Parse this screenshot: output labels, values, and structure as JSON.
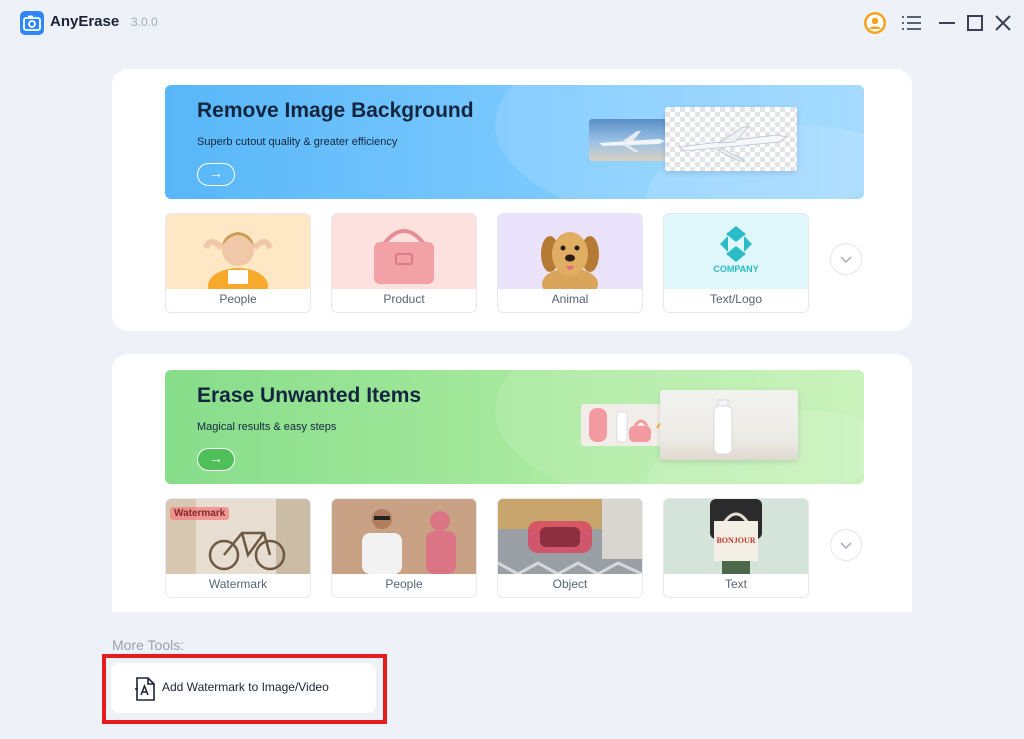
{
  "app": {
    "name": "AnyErase",
    "version": "3.0.0"
  },
  "titlebar": {
    "icons": [
      "user-avatar-icon",
      "menu-icon",
      "minimize-icon",
      "maximize-icon",
      "close-icon"
    ]
  },
  "remove_bg": {
    "title": "Remove Image Background",
    "subtitle": "Superb cutout quality & greater efficiency",
    "categories": [
      "People",
      "Product",
      "Animal",
      "Text/Logo"
    ],
    "logo_text": "COMPANY"
  },
  "erase": {
    "title": "Erase Unwanted Items",
    "subtitle": "Magical results & easy steps",
    "categories": [
      "Watermark",
      "People",
      "Object",
      "Text"
    ],
    "watermark_tag": "Watermark",
    "bag_text": "BONJOUR"
  },
  "more_tools": {
    "heading": "More Tools:",
    "items": [
      {
        "label": "Add Watermark to Image/Video"
      }
    ]
  },
  "colors": {
    "accent": "#2f86f6",
    "blue_banner": "#6ec2fb",
    "green_banner": "#a9ea9f",
    "highlight": "#e51d1d"
  }
}
